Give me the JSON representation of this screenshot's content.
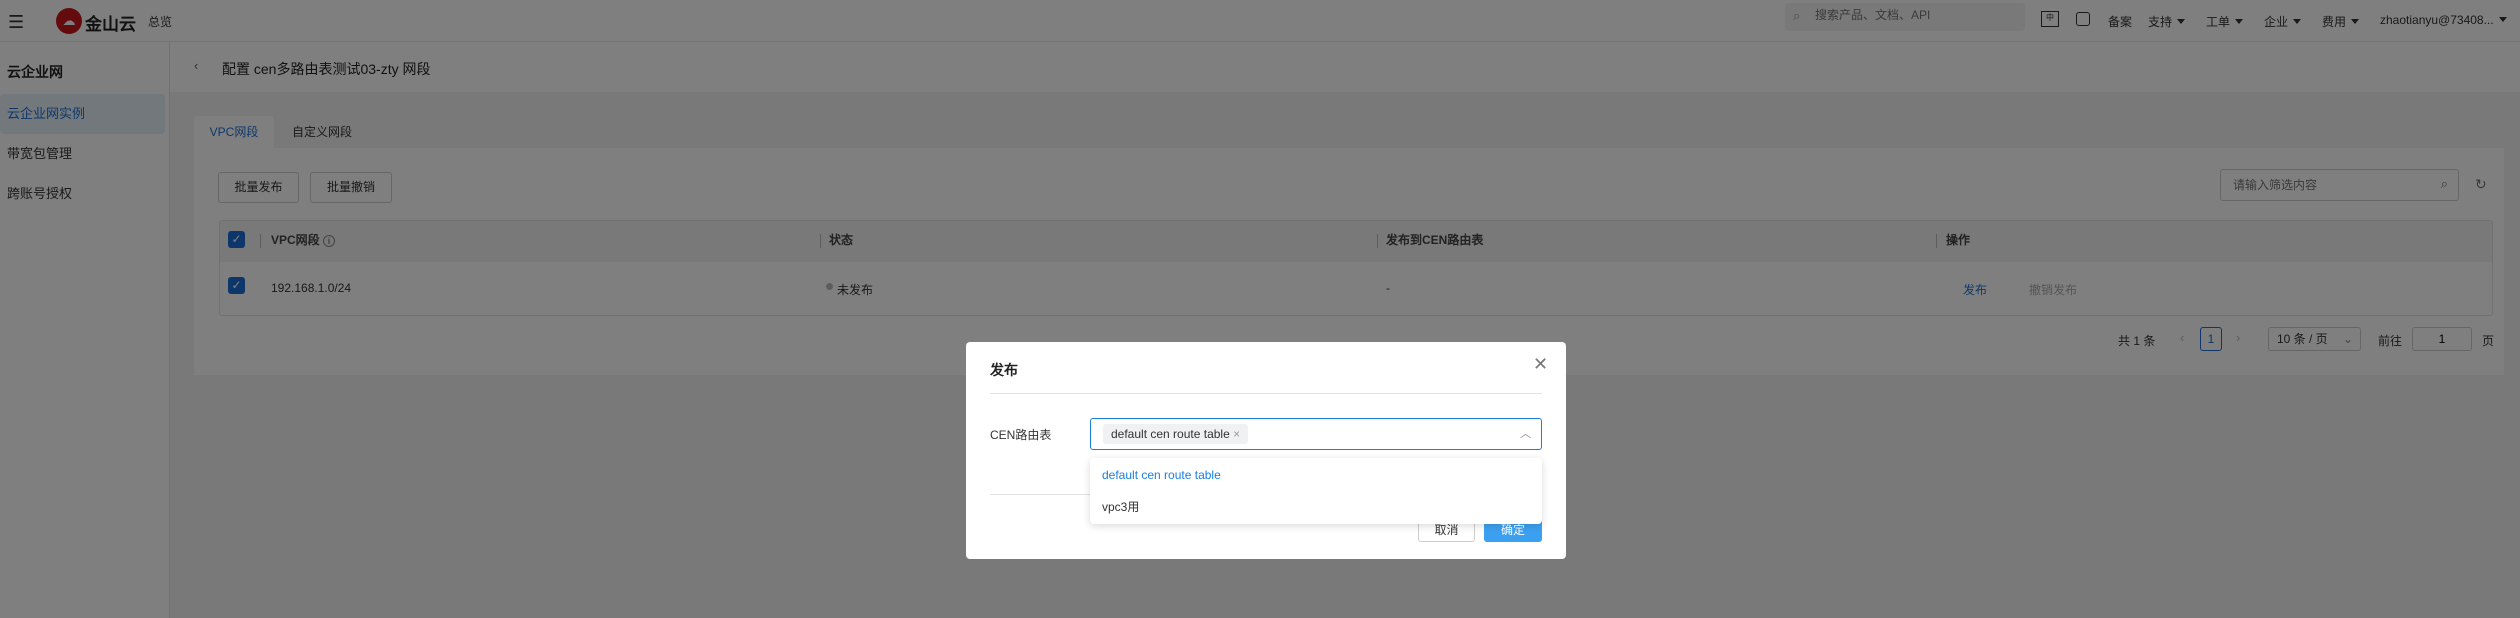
{
  "topbar": {
    "brand": "金山云",
    "overview": "总览",
    "search_placeholder": "搜索产品、文档、API",
    "beian": "备案",
    "support": "支持",
    "ticket": "工单",
    "enterprise": "企业",
    "billing": "费用",
    "user": "zhaotianyu@73408..."
  },
  "sidebar": {
    "title": "云企业网",
    "items": [
      {
        "label": "云企业网实例",
        "active": true
      },
      {
        "label": "带宽包管理"
      },
      {
        "label": "跨账号授权"
      }
    ]
  },
  "page": {
    "title": "配置 cen多路由表测试03-zty 网段"
  },
  "tabs": [
    {
      "label": "VPC网段",
      "active": true
    },
    {
      "label": "自定义网段"
    }
  ],
  "toolbar": {
    "batch_publish": "批量发布",
    "batch_revoke": "批量撤销",
    "filter_placeholder": "请输入筛选内容"
  },
  "table": {
    "columns": [
      "VPC网段",
      "状态",
      "发布到CEN路由表",
      "操作"
    ],
    "rows": [
      {
        "cidr": "192.168.1.0/24",
        "status": "未发布",
        "route_table": "-",
        "action_publish": "发布",
        "action_revoke": "撤销发布"
      }
    ]
  },
  "pagination": {
    "total": "共 1 条",
    "current": "1",
    "page_size": "10 条 / 页",
    "goto": "前往",
    "goto_value": "1",
    "page_unit": "页"
  },
  "modal": {
    "title": "发布",
    "field_label": "CEN路由表",
    "selected_tag": "default cen route table",
    "options": [
      {
        "label": "default cen route table",
        "selected": true
      },
      {
        "label": "vpc3用"
      }
    ],
    "cancel": "取消",
    "confirm": "确定"
  },
  "colors": {
    "accent": "#1a7fe0",
    "confirm": "#3ca0f0"
  }
}
